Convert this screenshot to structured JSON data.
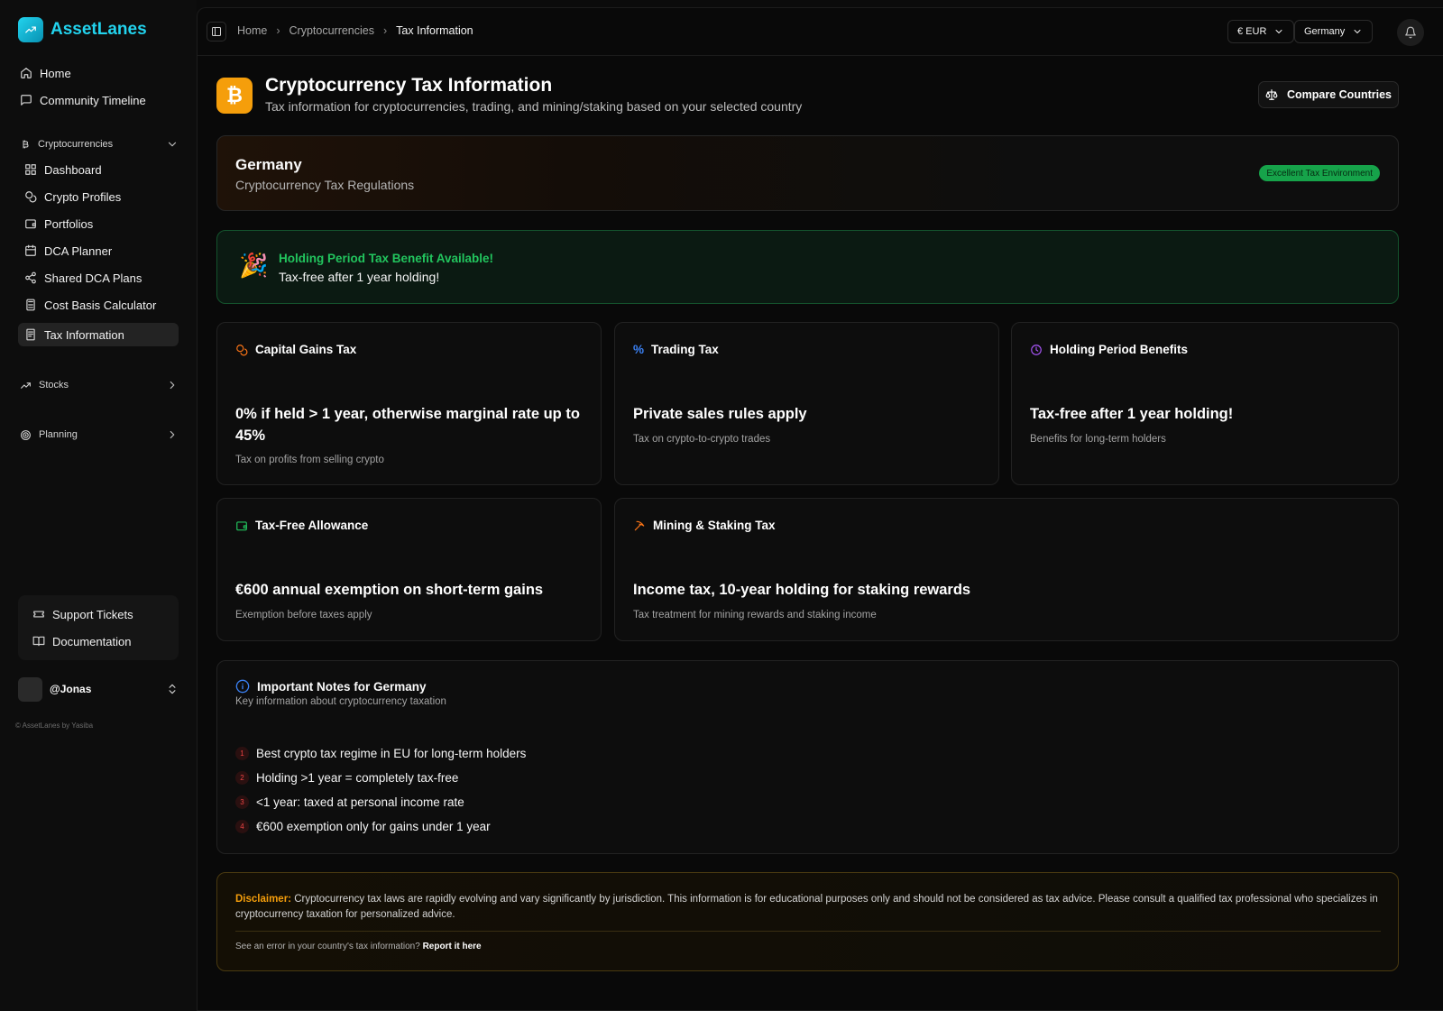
{
  "app": {
    "name": "AssetLanes",
    "copyright": "© AssetLanes by Yasiba"
  },
  "sidebar": {
    "top_items": [
      {
        "label": "Home",
        "icon": "home-icon"
      },
      {
        "label": "Community Timeline",
        "icon": "message-square-icon"
      }
    ],
    "crypto_section": {
      "label": "Cryptocurrencies",
      "icon": "bitcoin-icon"
    },
    "crypto_items": [
      {
        "label": "Dashboard",
        "icon": "grid-icon"
      },
      {
        "label": "Crypto Profiles",
        "icon": "coins-icon"
      },
      {
        "label": "Portfolios",
        "icon": "wallet-icon"
      },
      {
        "label": "DCA Planner",
        "icon": "calendar-icon"
      },
      {
        "label": "Shared DCA Plans",
        "icon": "share-icon"
      },
      {
        "label": "Cost Basis Calculator",
        "icon": "calculator-icon"
      },
      {
        "label": "Tax Information",
        "icon": "receipt-icon"
      }
    ],
    "stocks_section": {
      "label": "Stocks",
      "icon": "trending-up-icon"
    },
    "planning_section": {
      "label": "Planning",
      "icon": "target-icon"
    },
    "support_items": [
      {
        "label": "Support Tickets",
        "icon": "ticket-icon"
      },
      {
        "label": "Documentation",
        "icon": "book-icon"
      }
    ],
    "user": {
      "name": "@Jonas"
    }
  },
  "topbar": {
    "breadcrumb": [
      "Home",
      "Cryptocurrencies",
      "Tax Information"
    ],
    "currency": "€ EUR",
    "country": "Germany"
  },
  "header": {
    "icon_glyph": "₿",
    "title": "Cryptocurrency Tax Information",
    "subtitle": "Tax information for cryptocurrencies, trading, and mining/staking based on your selected country",
    "compare_label": "Compare Countries"
  },
  "country_card": {
    "name": "Germany",
    "subtitle": "Cryptocurrency Tax Regulations",
    "badge": "Excellent Tax Environment"
  },
  "benefit": {
    "emoji": "🎉",
    "title": "Holding Period Tax Benefit Available!",
    "text": "Tax-free after 1 year holding!"
  },
  "cards": {
    "capital": {
      "title": "Capital Gains Tax",
      "value": "0% if held > 1 year, otherwise marginal rate up to 45%",
      "desc": "Tax on profits from selling crypto"
    },
    "trading": {
      "title": "Trading Tax",
      "value": "Private sales rules apply",
      "desc": "Tax on crypto-to-crypto trades"
    },
    "holding": {
      "title": "Holding Period Benefits",
      "value": "Tax-free after 1 year holding!",
      "desc": "Benefits for long-term holders"
    },
    "allowance": {
      "title": "Tax-Free Allowance",
      "value": "€600 annual exemption on short-term gains",
      "desc": "Exemption before taxes apply"
    },
    "mining": {
      "title": "Mining & Staking Tax",
      "value": "Income tax, 10-year holding for staking rewards",
      "desc": "Tax treatment for mining rewards and staking income"
    }
  },
  "colors": {
    "capital": "#f97316",
    "trading": "#3b82f6",
    "holding": "#a855f7",
    "allowance": "#22c55e",
    "mining": "#f97316",
    "info": "#3b82f6"
  },
  "notes": {
    "title": "Important Notes for Germany",
    "subtitle": "Key information about cryptocurrency taxation",
    "items": [
      {
        "num": "1",
        "text": "Best crypto tax regime in EU for long-term holders"
      },
      {
        "num": "2",
        "text": "Holding >1 year = completely tax-free"
      },
      {
        "num": "3",
        "text": "<1 year: taxed at personal income rate"
      },
      {
        "num": "4",
        "text": "€600 exemption only for gains under 1 year"
      }
    ]
  },
  "disclaimer": {
    "label": "Disclaimer:",
    "text": "Cryptocurrency tax laws are rapidly evolving and vary significantly by jurisdiction. This information is for educational purposes only and should not be considered as tax advice. Please consult a qualified tax professional who specializes in cryptocurrency taxation for personalized advice.",
    "footer": "See an error in your country's tax information?",
    "link": "Report it here"
  }
}
